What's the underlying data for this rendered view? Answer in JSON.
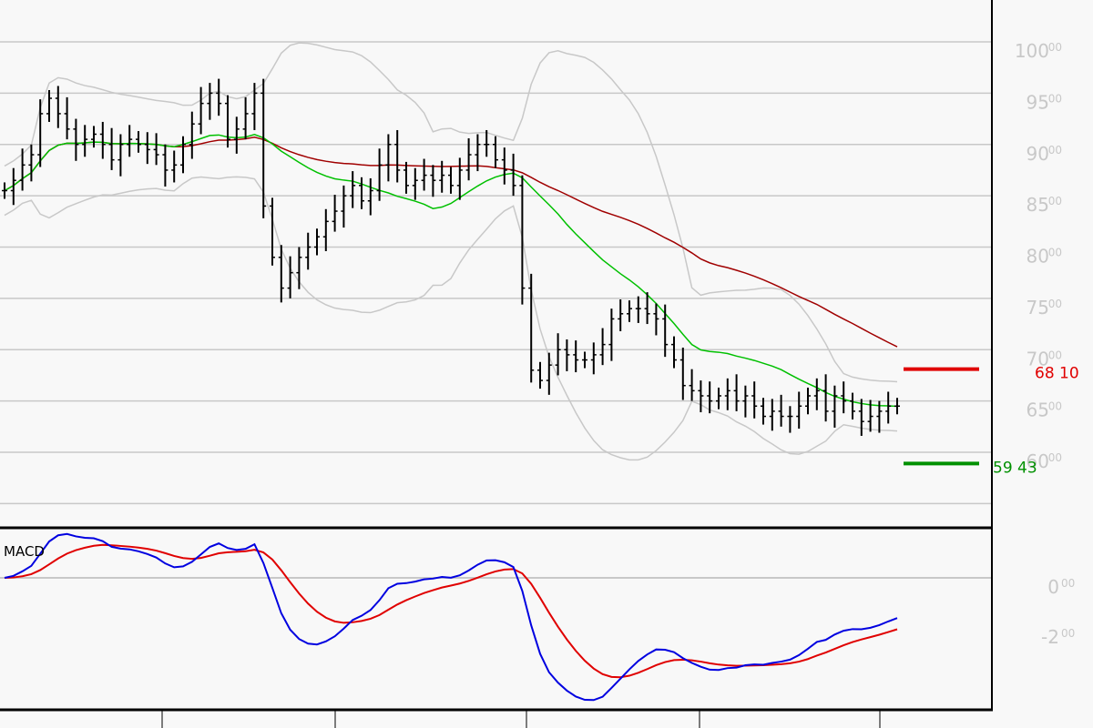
{
  "chart_data": [
    {
      "type": "bar",
      "subtype": "ohlc",
      "title": "",
      "y_axis_side": "right",
      "ylim": [
        55,
        102
      ],
      "yticks": [
        {
          "value": 100,
          "int": "100",
          "dec": "00"
        },
        {
          "value": 95,
          "int": "95",
          "dec": "00"
        },
        {
          "value": 90,
          "int": "90",
          "dec": "00"
        },
        {
          "value": 85,
          "int": "85",
          "dec": "00"
        },
        {
          "value": 80,
          "int": "80",
          "dec": "00"
        },
        {
          "value": 75,
          "int": "75",
          "dec": "00"
        },
        {
          "value": 70,
          "int": "70",
          "dec": "00"
        },
        {
          "value": 65,
          "int": "65",
          "dec": "00"
        },
        {
          "value": 60,
          "int": "60",
          "dec": "00"
        }
      ],
      "extra_gridlines": [
        55
      ],
      "close": [
        85.5,
        86.5,
        88,
        89,
        93,
        94.5,
        93,
        91.5,
        90,
        90.5,
        91,
        90,
        88.5,
        90,
        90.5,
        90,
        89.5,
        89,
        87.5,
        88,
        90,
        92,
        94,
        95,
        94,
        90.5,
        91.5,
        93,
        95,
        84,
        79,
        76,
        77.5,
        79,
        80,
        81,
        82.5,
        83.5,
        85,
        86,
        84.5,
        85.5,
        88,
        90,
        87.5,
        86,
        86.5,
        87,
        86.5,
        87,
        86,
        87.5,
        89,
        90,
        90,
        88.5,
        87.5,
        86,
        76,
        68,
        67,
        68.5,
        70,
        69.5,
        69,
        69,
        69.5,
        70.5,
        73,
        73.5,
        74,
        74,
        73.5,
        73,
        70.5,
        69,
        66.5,
        66,
        65.5,
        65,
        65.5,
        66,
        65,
        65.5,
        64.5,
        63.5,
        64,
        63.5,
        63.5,
        64.5,
        65.5,
        66,
        64,
        65.5,
        65,
        64,
        63,
        63.5,
        64,
        64.5,
        64.5
      ],
      "overlays": [
        {
          "name": "SMA 20",
          "color": "#00c000"
        },
        {
          "name": "SMA 50",
          "color": "#a00000"
        },
        {
          "name": "Bollinger Bands (20,2)",
          "color": "#c8c8c8"
        }
      ],
      "markers": [
        {
          "value": 68.1,
          "int": "68",
          "dec": "10",
          "color": "#e00000"
        },
        {
          "value": 59.43,
          "int": "59",
          "dec": "43",
          "color": "#009000"
        }
      ]
    },
    {
      "type": "line",
      "title": "MACD",
      "series": [
        {
          "name": "MACD",
          "color": "#0000e0"
        },
        {
          "name": "Signal",
          "color": "#e00000"
        }
      ],
      "yticks": [
        {
          "value": 0,
          "int": "0",
          "dec": "00"
        },
        {
          "value": -2,
          "int": "-2",
          "dec": "00"
        }
      ],
      "params": {
        "fast": 12,
        "slow": 26,
        "signal": 9
      }
    }
  ]
}
